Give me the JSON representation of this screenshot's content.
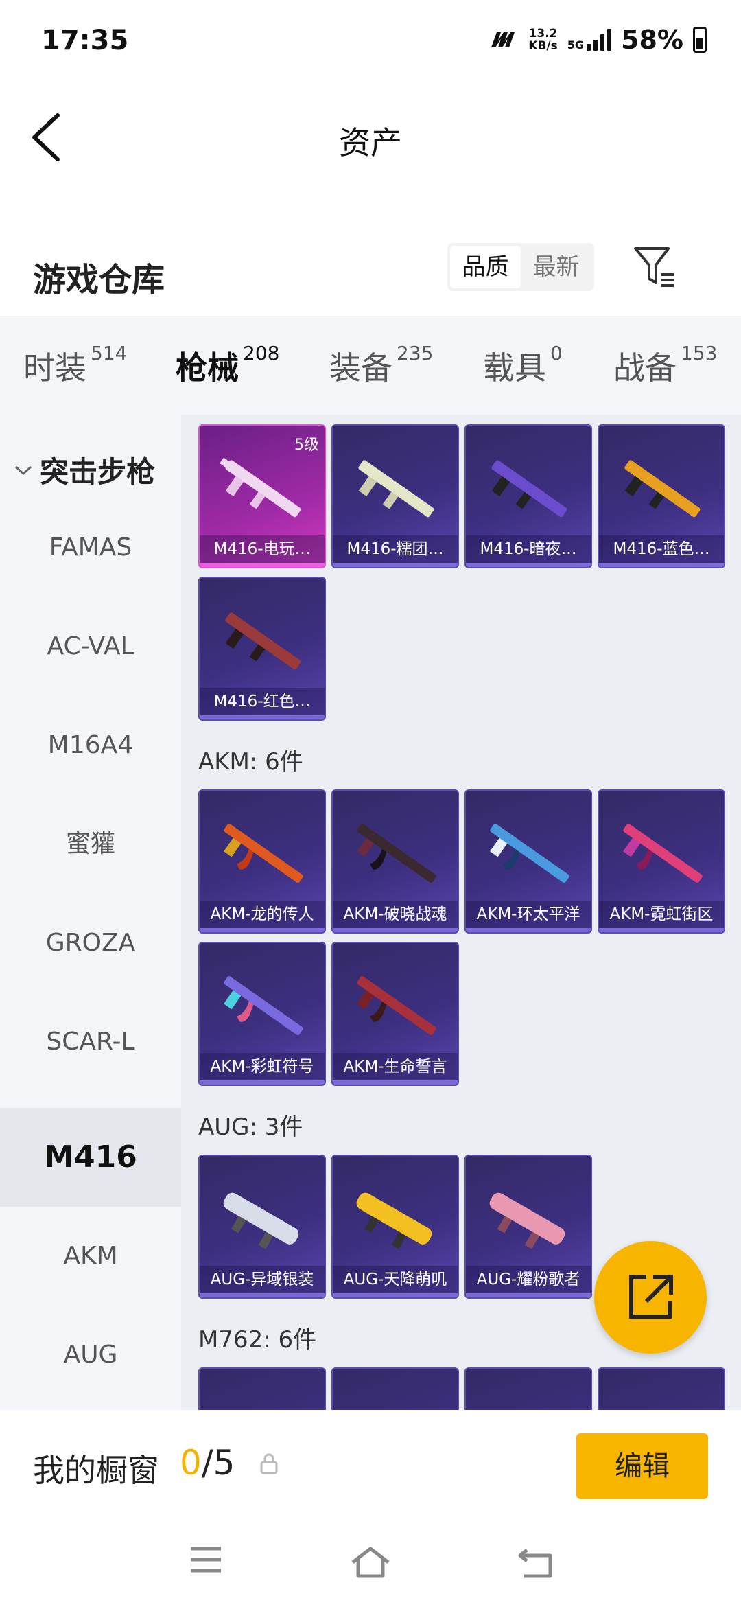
{
  "status": {
    "time": "17:35",
    "speed_value": "13.2",
    "speed_unit": "KB/s",
    "network": "5G",
    "battery": "58%"
  },
  "header": {
    "title": "资产"
  },
  "warehouse": {
    "title": "游戏仓库",
    "sort_options": [
      "品质",
      "最新"
    ],
    "active_sort": "品质"
  },
  "tabs": [
    {
      "label": "时装",
      "count": "514"
    },
    {
      "label": "枪械",
      "count": "208",
      "active": true
    },
    {
      "label": "装备",
      "count": "235"
    },
    {
      "label": "载具",
      "count": "0"
    },
    {
      "label": "战备",
      "count": "153"
    }
  ],
  "sidebar": {
    "category": "突击步枪",
    "items": [
      "FAMAS",
      "AC-VAL",
      "M16A4",
      "蜜獾",
      "GROZA",
      "SCAR-L",
      "M416",
      "AKM",
      "AUG"
    ],
    "selected": "M416"
  },
  "groups": {
    "m416": {
      "items": [
        {
          "name": "M416-电玩…",
          "level": "5级"
        },
        {
          "name": "M416-糯团…"
        },
        {
          "name": "M416-暗夜…"
        },
        {
          "name": "M416-蓝色…"
        },
        {
          "name": "M416-红色…"
        }
      ]
    },
    "akm": {
      "title": "AKM: 6件",
      "items": [
        {
          "name": "AKM-龙的传人"
        },
        {
          "name": "AKM-破晓战魂"
        },
        {
          "name": "AKM-环太平洋"
        },
        {
          "name": "AKM-霓虹街区"
        },
        {
          "name": "AKM-彩虹符号"
        },
        {
          "name": "AKM-生命誓言"
        }
      ]
    },
    "aug": {
      "title": "AUG: 3件",
      "items": [
        {
          "name": "AUG-异域银装"
        },
        {
          "name": "AUG-天降萌叽"
        },
        {
          "name": "AUG-耀粉歌者"
        }
      ]
    },
    "m762": {
      "title": "M762: 6件"
    }
  },
  "showcase": {
    "label": "我的橱窗",
    "current": "0",
    "total": "/5",
    "edit_label": "编辑"
  },
  "colors": {
    "accent": "#f7b500",
    "card": "#3d2f80",
    "card_gold": "#a02aa6"
  }
}
